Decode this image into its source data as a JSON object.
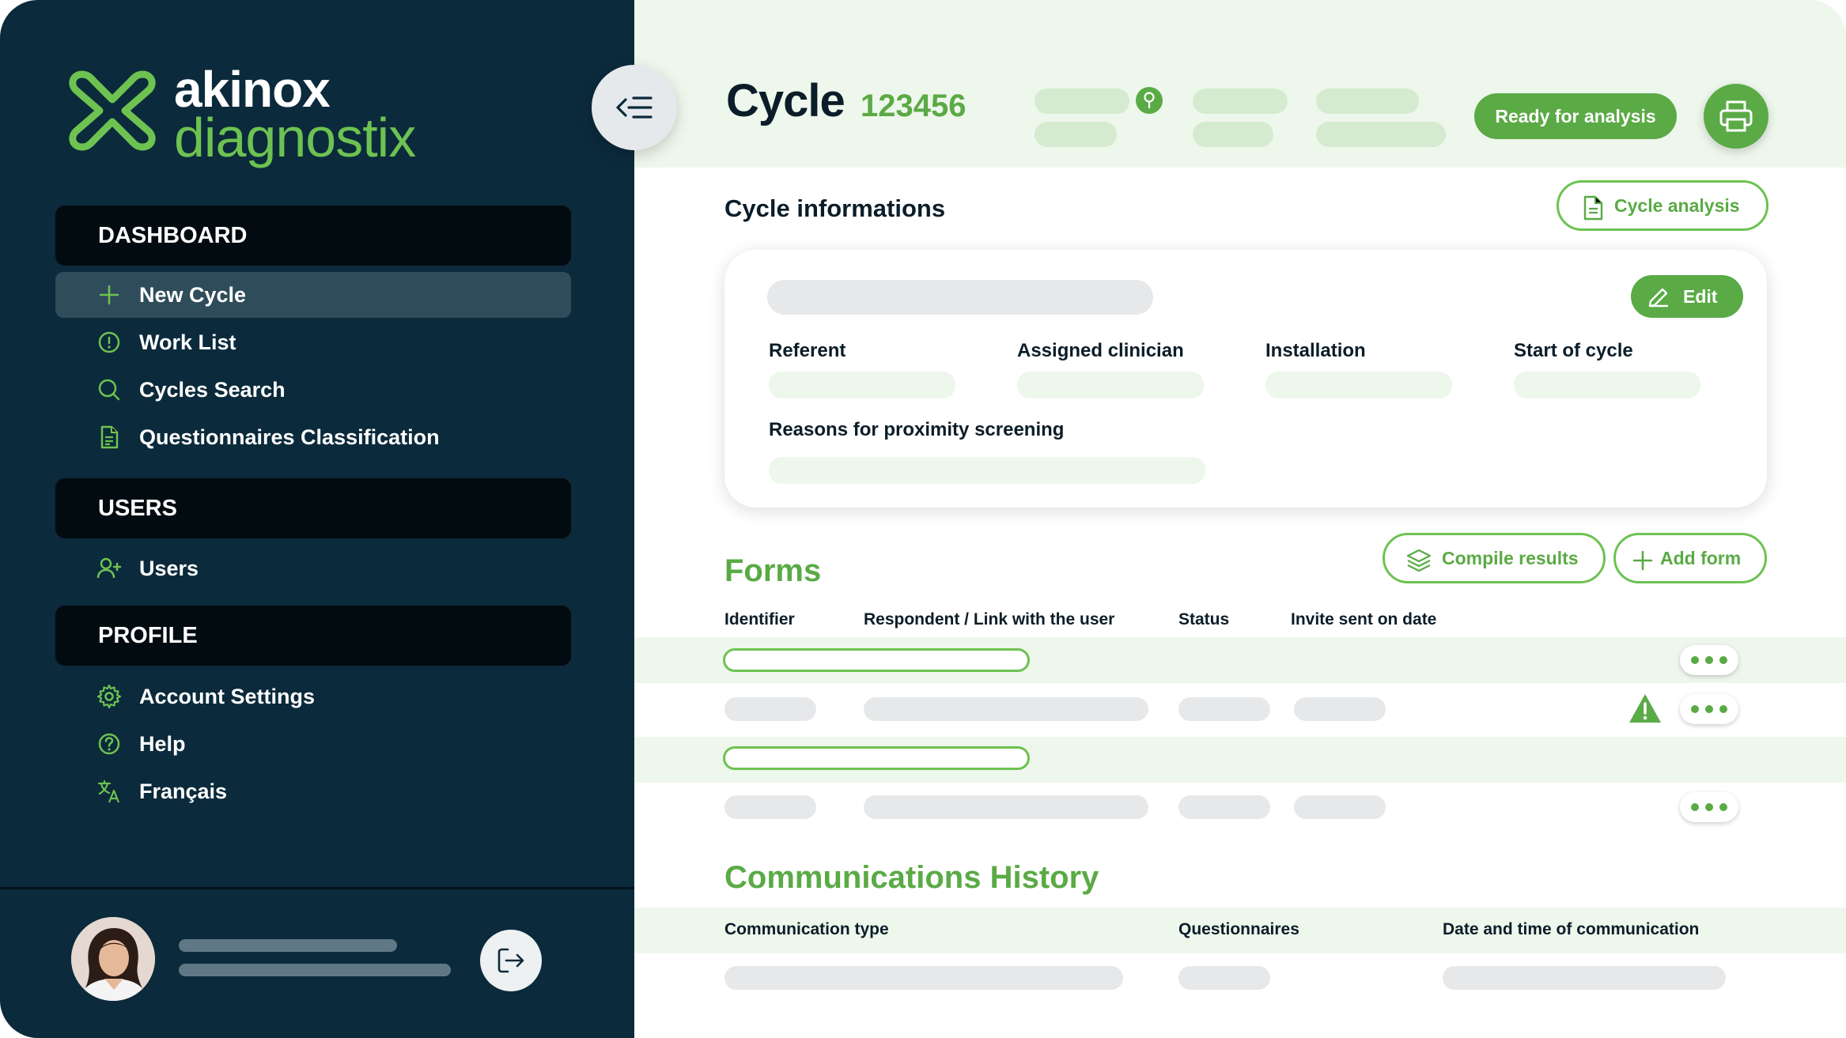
{
  "brand": {
    "line1": "akinox",
    "line2": "diagnostix"
  },
  "sidebar": {
    "sections": [
      {
        "title": "DASHBOARD"
      },
      {
        "title": "USERS"
      },
      {
        "title": "PROFILE"
      }
    ],
    "items": [
      {
        "label": "New Cycle",
        "icon": "plus-icon",
        "active": true
      },
      {
        "label": "Work List",
        "icon": "alert-circle-icon"
      },
      {
        "label": "Cycles Search",
        "icon": "search-icon"
      },
      {
        "label": "Questionnaires Classification",
        "icon": "document-icon"
      },
      {
        "label": "Users",
        "icon": "user-plus-icon"
      },
      {
        "label": "Account Settings",
        "icon": "gear-icon"
      },
      {
        "label": "Help",
        "icon": "help-circle-icon"
      },
      {
        "label": "Français",
        "icon": "translate-icon"
      }
    ]
  },
  "header": {
    "title": "Cycle",
    "cycle_id": "123456",
    "ready_label": "Ready for analysis"
  },
  "cycle_info": {
    "title": "Cycle informations",
    "analysis_button": "Cycle analysis",
    "edit_button": "Edit",
    "fields": [
      "Referent",
      "Assigned clinician",
      "Installation",
      "Start of cycle"
    ],
    "reasons_label": "Reasons for proximity screening"
  },
  "forms": {
    "title": "Forms",
    "compile_button": "Compile results",
    "add_button": "Add form",
    "columns": [
      "Identifier",
      "Respondent / Link with the user",
      "Status",
      "Invite sent on date"
    ]
  },
  "communications": {
    "title": "Communications History",
    "columns": [
      "Communication type",
      "Questionnaires",
      "Date and time of communication"
    ]
  },
  "colors": {
    "sidebar_bg": "#0b2a3b",
    "accent_green": "#5aaa45",
    "light_green": "#eef7ec",
    "section_bg": "#020b10"
  }
}
